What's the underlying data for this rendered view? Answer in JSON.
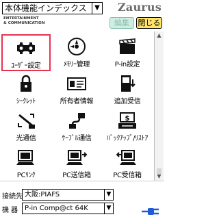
{
  "header": {
    "index_selector_value": "本体機能インデックス",
    "brand": "Zaurus",
    "subtitle_line1": "ENTERTAINMENT",
    "subtitle_line2": "& COMMUNICATION",
    "edit_label": "編集",
    "close_label": "閉じる"
  },
  "apps": [
    {
      "label": "ﾕｰｻﾞｰ設定",
      "icon": "gear-icon",
      "selected": true
    },
    {
      "label": "ﾒﾓﾘｰ管理",
      "icon": "memory-disc-icon"
    },
    {
      "label": "P-in設定",
      "icon": "clapperboard-icon"
    },
    {
      "label": "ｼｰｸﾚｯﾄ",
      "icon": "lock-icon"
    },
    {
      "label": "所有者情報",
      "icon": "id-card-icon"
    },
    {
      "label": "追加受信",
      "icon": "phone-receive-icon"
    },
    {
      "label": "光通信",
      "icon": "infrared-icon"
    },
    {
      "label": "ｹｰﾌﾞﾙ通信",
      "icon": "cable-icon"
    },
    {
      "label": "ﾊﾞｯｸｱｯﾌﾟ/ﾘｽﾄｱ",
      "icon": "backup-icon"
    },
    {
      "label": "PCﾘﾝｸ",
      "icon": "pc-link-icon"
    },
    {
      "label": "PC送信箱",
      "icon": "pc-outbox-icon"
    },
    {
      "label": "PC受信箱",
      "icon": "pc-inbox-icon"
    }
  ],
  "footer": {
    "connection_label": "接続先",
    "connection_value": "大阪:PIAFS",
    "device_label": "機 器",
    "device_value": "P-in Comp@ct 64K"
  },
  "colors": {
    "selected_border": "#e8304f",
    "edit_bg": "#cfeee2",
    "close_bg": "#ffe36a",
    "plug": "#1e5bd6"
  }
}
